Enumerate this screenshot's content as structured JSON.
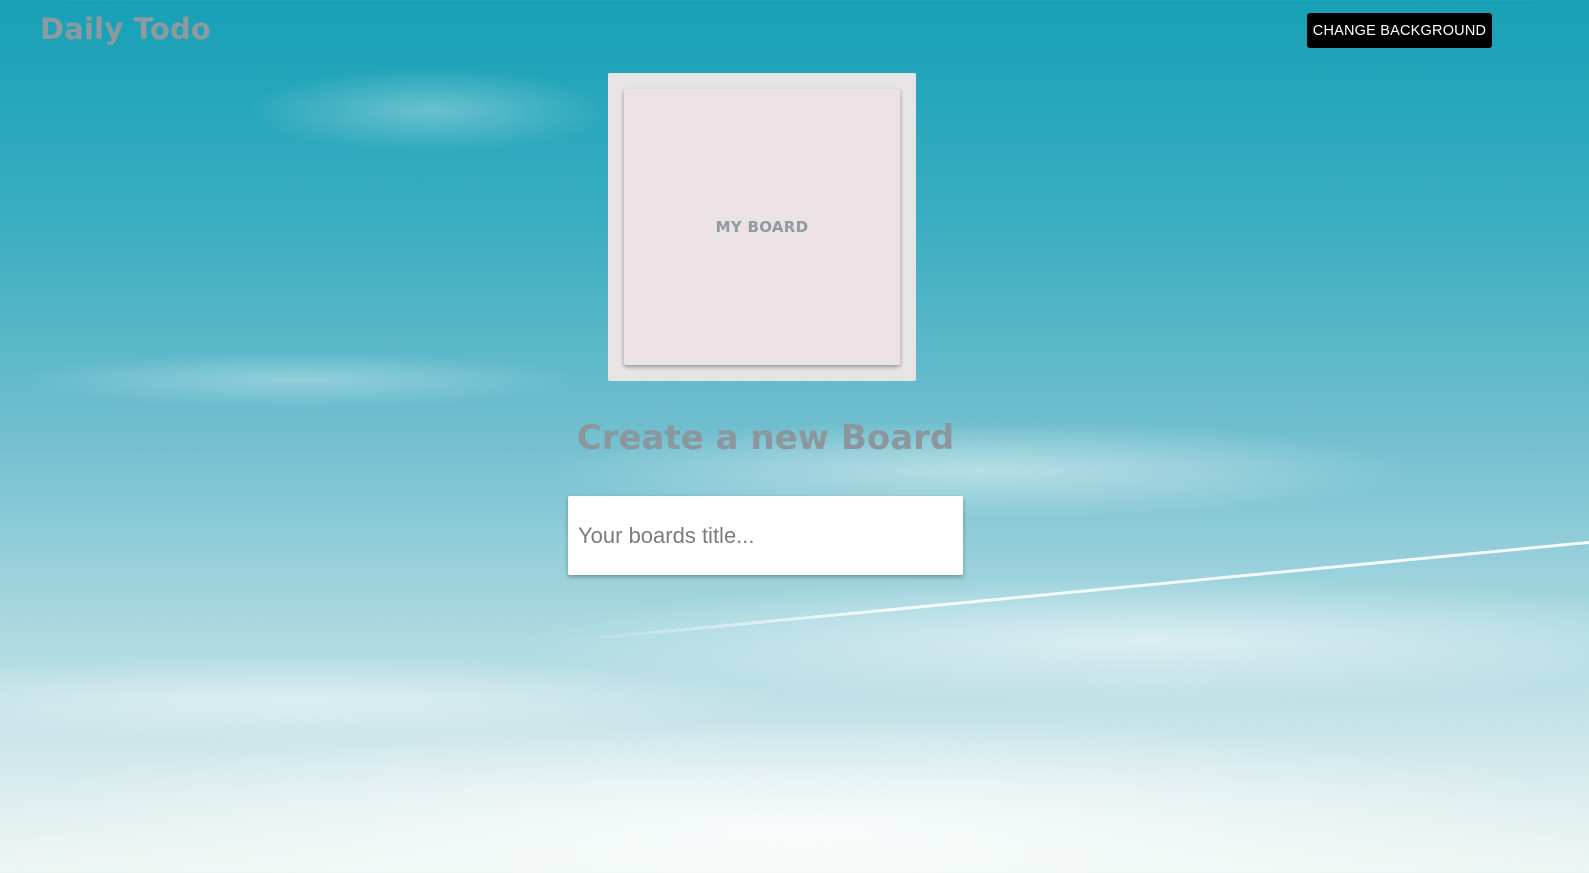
{
  "header": {
    "app_title": "Daily Todo",
    "change_background_label": "CHANGE BACKGROUND"
  },
  "boards": [
    {
      "title": "MY BOARD"
    }
  ],
  "create_board": {
    "heading": "Create a new Board",
    "input_placeholder": "Your boards title...",
    "input_value": ""
  },
  "colors": {
    "sky_top": "#16a0b6",
    "sky_bottom": "#eef6f4",
    "board_tile": "#ece1e4",
    "board_frame": "#e6e4e5",
    "button_bg": "#000000",
    "muted_text": "#8e9aa0"
  }
}
